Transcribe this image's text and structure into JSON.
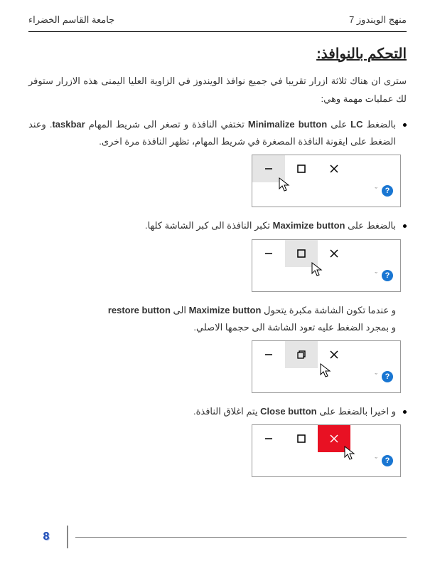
{
  "header": {
    "right": "منهج الويندوز 7",
    "left": "جامعة القاسم الخضراء"
  },
  "title": "التحكم بالنوافذ:",
  "intro": "سترى ان هناك ثلاثة ازرار تقريبا في جميع نوافذ الويندوز في الزاوية العليا اليمنى هذه الازرار ستوفر لك عمليات مهمة وهي:",
  "bullets": {
    "b1": {
      "pre": "بالضغط ",
      "bold1": "LC",
      "mid1": " على ",
      "bold2": "Minimalize button",
      "tail": " تختفي النافذة و تصغر الى شريط المهام ",
      "bold3": "taskbar",
      "tail2": ". وعند الضغط على ايقونة النافذة المصغرة في شريط المهام، تظهر النافذة مرة اخرى."
    },
    "b2": {
      "pre": "بالضغط على ",
      "bold": "Maximize button",
      "tail": " تكبر النافذة الى كبر الشاشة كلها."
    },
    "b3": {
      "pre": "و عندما تكون الشاشة مكبرة يتحول ",
      "bold1": "Maximize button",
      "mid": " الى ",
      "bold2": "restore button",
      "tail": "و بمجرد الضغط عليه تعود الشاشة الى حجمها الاصلي."
    },
    "b4": {
      "pre": "و اخيرا بالضغط على ",
      "bold": "Close button",
      "tail": " يتم اغلاق النافذة."
    }
  },
  "help": {
    "chevron": "ˇ",
    "q": "?"
  },
  "page_num": "8"
}
